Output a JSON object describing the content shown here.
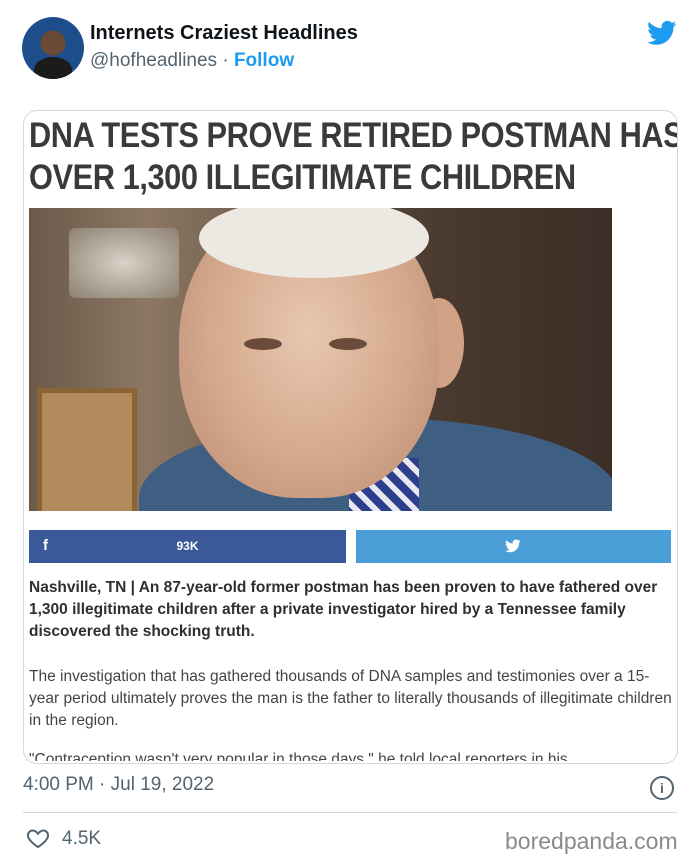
{
  "tweet": {
    "author_name": "Internets Craziest Headlines",
    "handle": "@hofheadlines",
    "separator": "·",
    "follow_label": "Follow",
    "timestamp": "4:00 PM · Jul 19, 2022",
    "likes": "4.5K",
    "info_glyph": "i"
  },
  "article": {
    "headline_line1": "DNA TESTS PROVE RETIRED POSTMAN HAS",
    "headline_line2": "OVER 1,300 ILLEGITIMATE CHILDREN",
    "share_count": "93K",
    "facebook_glyph": "f",
    "lead": "Nashville, TN | An 87-year-old former postman has been proven to have fathered over 1,300 illegitimate children after a private investigator hired by a Tennessee family discovered the shocking truth.",
    "body": "The investigation that has gathered thousands of DNA samples and testimonies over a 15-year period ultimately proves the man is the father to literally thousands of illegitimate children in the region.",
    "cut_line": "\"Contraception wasn't very popular in those days,\" he told local reporters in his"
  },
  "watermark": "boredpanda.com",
  "colors": {
    "twitter_blue": "#1d9bf0",
    "facebook_blue": "#3b5998",
    "share_blue": "#4b9fd8",
    "muted_text": "#536471"
  },
  "icons": {
    "bird": "twitter-bird-icon",
    "heart": "heart-icon",
    "info": "info-icon",
    "facebook": "facebook-icon"
  }
}
